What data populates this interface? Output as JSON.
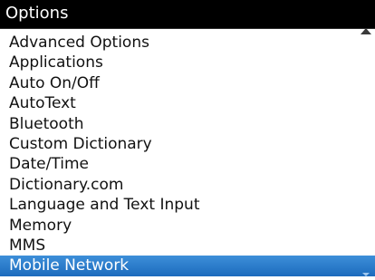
{
  "title": "Options",
  "items": [
    {
      "label": "Advanced Options"
    },
    {
      "label": "Applications"
    },
    {
      "label": "Auto On/Off"
    },
    {
      "label": "AutoText"
    },
    {
      "label": "Bluetooth"
    },
    {
      "label": "Custom Dictionary"
    },
    {
      "label": "Date/Time"
    },
    {
      "label": "Dictionary.com"
    },
    {
      "label": "Language and Text Input"
    },
    {
      "label": "Memory"
    },
    {
      "label": "MMS"
    },
    {
      "label": "Mobile Network",
      "selected": true
    }
  ],
  "colors": {
    "title_background": "#000000",
    "title_text": "#ffffff",
    "selection_background": "#2a7acb",
    "selection_text": "#ffffff",
    "item_text": "#111111"
  },
  "icons": {
    "scroll_up": "scroll-up-arrow",
    "scroll_down": "scroll-down-arrow"
  }
}
